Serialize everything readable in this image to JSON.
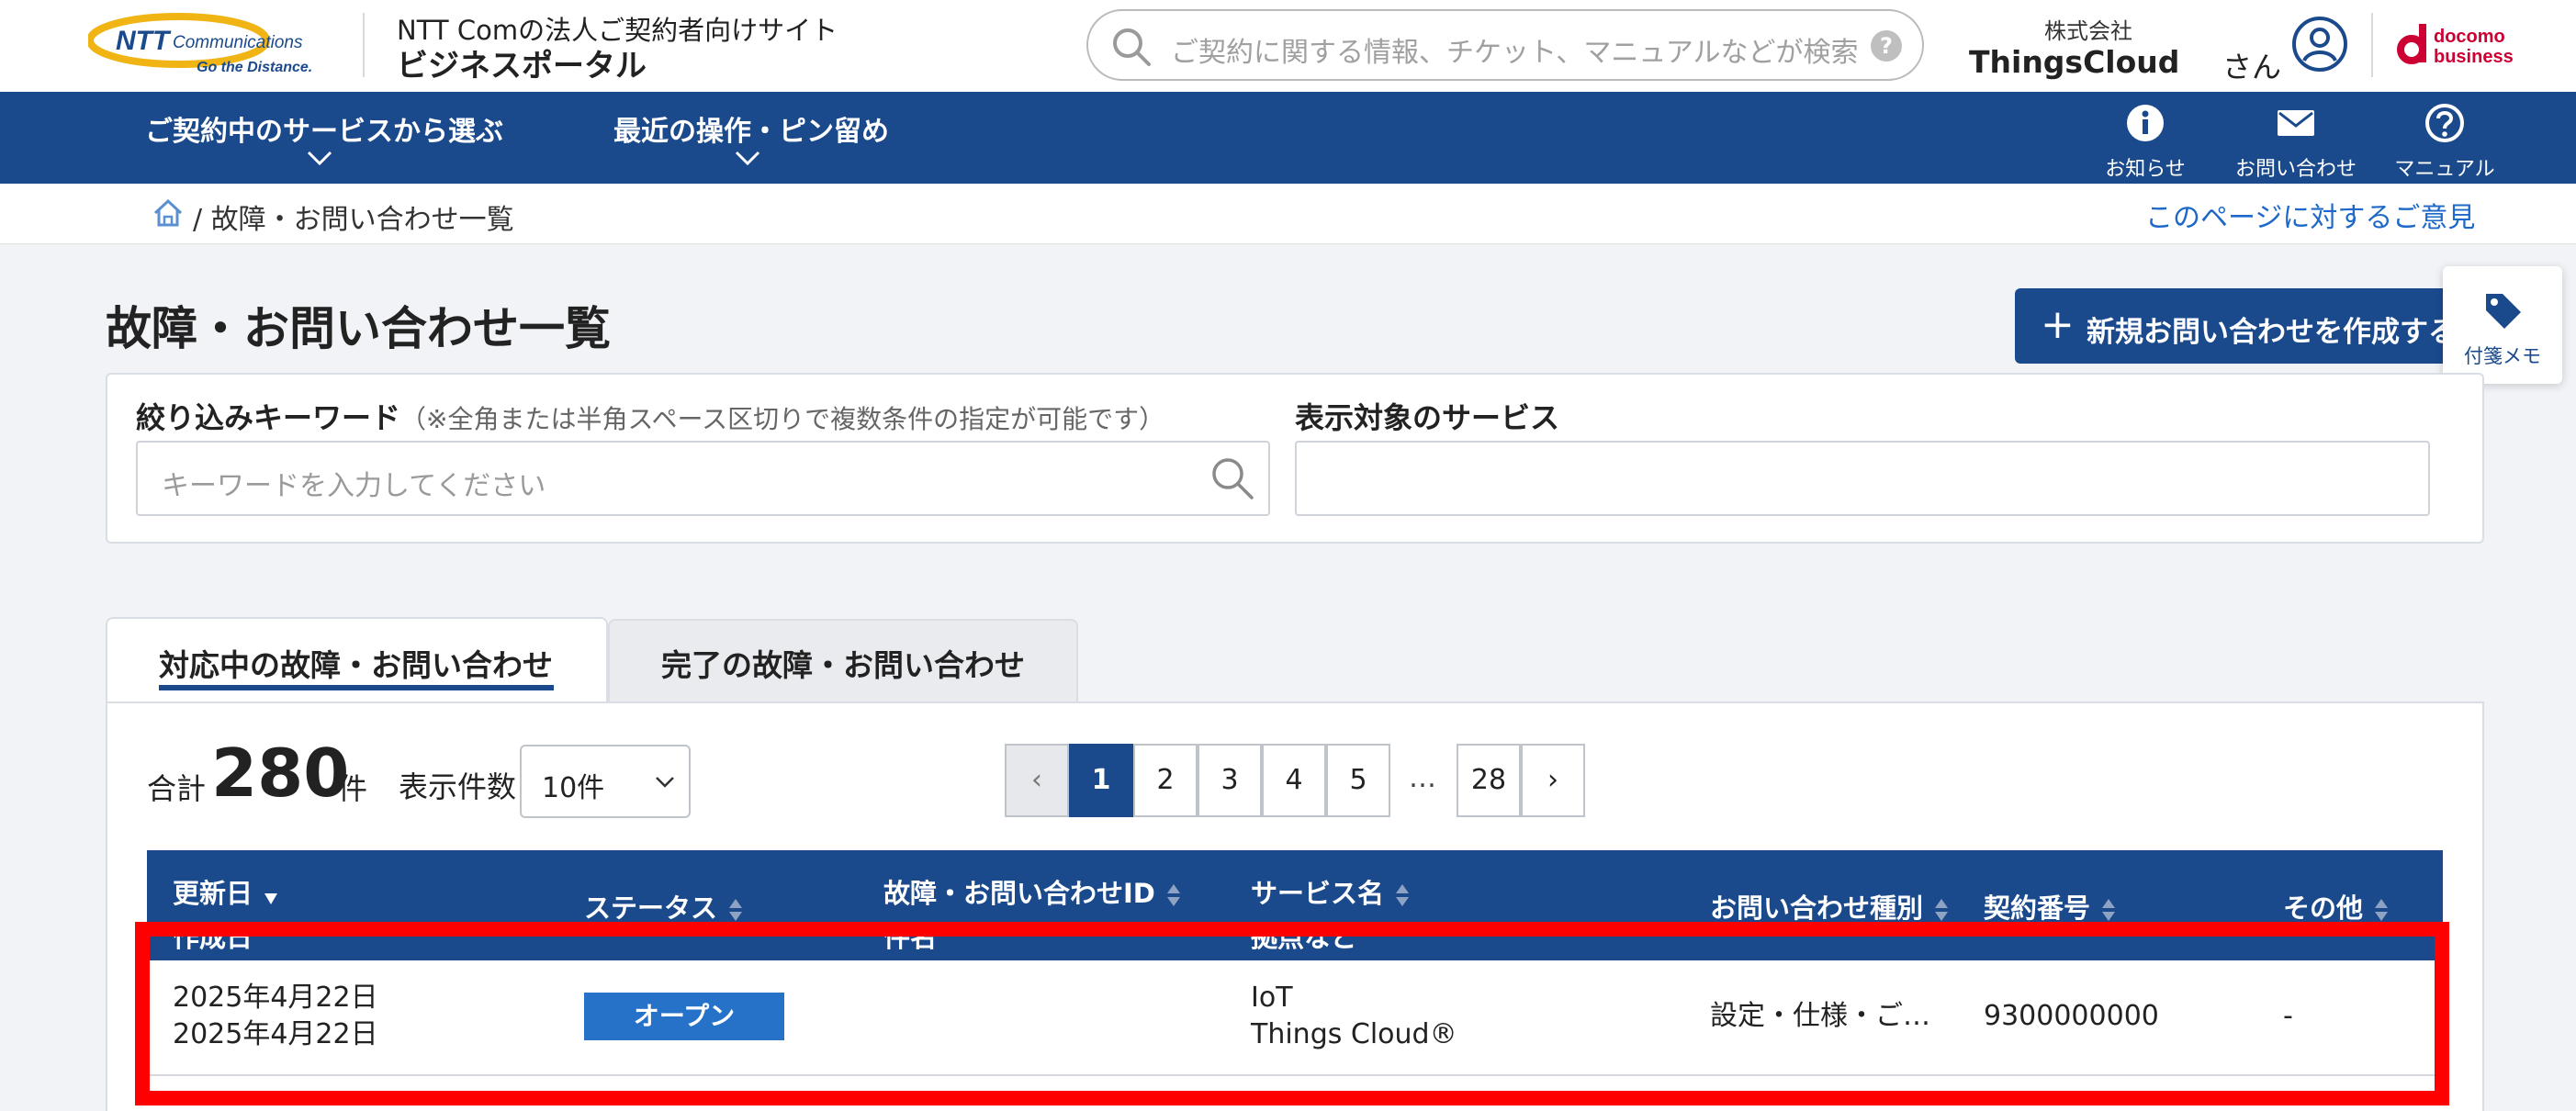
{
  "header": {
    "logo_text": "NTT Communications",
    "logo_tagline": "Go the Distance.",
    "site_subtitle": "NTT Comの法人ご契約者向けサイト",
    "site_title": "ビジネスポータル",
    "search_placeholder": "ご契約に関する情報、チケット、マニュアルなどが検索",
    "search_help": "?",
    "company_sub": "株式会社",
    "company_name": "ThingsCloud",
    "honorific": "さん",
    "docomo_logo_line1": "docomo",
    "docomo_logo_line2": "business"
  },
  "nav": {
    "items": [
      {
        "label": "ご契約中のサービスから選ぶ"
      },
      {
        "label": "最近の操作・ピン留め"
      }
    ],
    "tools": [
      {
        "label": "お知らせ",
        "icon": "info-icon"
      },
      {
        "label": "お問い合わせ",
        "icon": "mail-icon"
      },
      {
        "label": "マニュアル",
        "icon": "help-icon"
      }
    ]
  },
  "breadcrumb": {
    "separator": "/",
    "current": "故障・お問い合わせ一覧",
    "feedback": "このページに対するご意見"
  },
  "page": {
    "title": "故障・お問い合わせ一覧",
    "new_button": "新規お問い合わせを作成する",
    "memo": "付箋メモ"
  },
  "filter": {
    "keyword_label": "絞り込みキーワード",
    "keyword_hint": "（※全角または半角スペース区切りで複数条件の指定が可能です）",
    "keyword_placeholder": "キーワードを入力してください",
    "service_label": "表示対象のサービス",
    "service_value": ""
  },
  "tabs": [
    {
      "label": "対応中の故障・お問い合わせ",
      "active": true
    },
    {
      "label": "完了の故障・お問い合わせ",
      "active": false
    }
  ],
  "summary": {
    "total_label": "合計",
    "total": "280",
    "unit": "件",
    "per_page_label": "表示件数",
    "per_page": "10件"
  },
  "pagination": {
    "prev": "‹",
    "pages": [
      "1",
      "2",
      "3",
      "4",
      "5"
    ],
    "ellipsis": "…",
    "last": "28",
    "next": "›",
    "current": "1"
  },
  "table": {
    "columns": [
      {
        "line1": "更新日",
        "line2": "作成日"
      },
      {
        "line1": "ステータス",
        "line2": ""
      },
      {
        "line1": "故障・お問い合わせID",
        "line2": "件名"
      },
      {
        "line1": "サービス名",
        "line2": "拠点など"
      },
      {
        "line1": "お問い合わせ種別",
        "line2": ""
      },
      {
        "line1": "契約番号",
        "line2": ""
      },
      {
        "line1": "その他",
        "line2": ""
      }
    ],
    "rows": [
      {
        "updated": "2025年4月22日",
        "created": "2025年4月22日",
        "status": "オープン",
        "service_line1": "IoT",
        "service_line2": "Things Cloud®",
        "type": "設定・仕様・ご…",
        "contract": "9300000000",
        "other": "-"
      }
    ]
  },
  "colors": {
    "brand": "#1b4a8c",
    "status_open": "#2672c8",
    "link": "#1d68c8",
    "highlight": "#ff0000"
  }
}
